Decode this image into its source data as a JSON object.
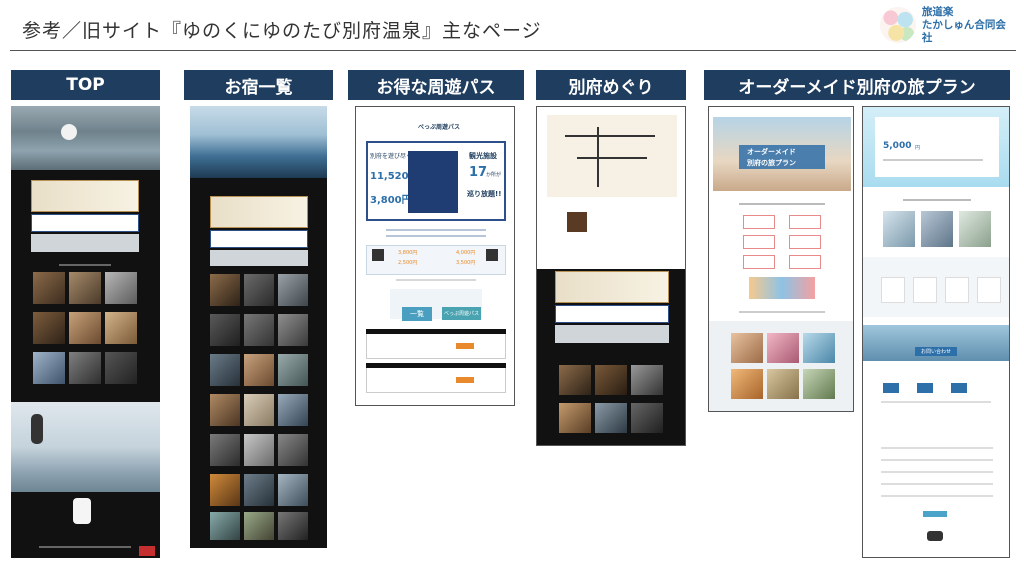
{
  "title": "参考／旧サイト『ゆのくにゆのたび別府温泉』主なページ",
  "logo": {
    "line1": "旅道楽",
    "line2": "たかしゅん合同会社",
    "icon": "flower-circle-logo"
  },
  "columns": [
    {
      "label": "TOP"
    },
    {
      "label": "お宿一覧"
    },
    {
      "label": "お得な周遊パス"
    },
    {
      "label": "別府めぐり"
    },
    {
      "label": "オーダーメイド別府の旅プラン"
    }
  ],
  "pass": {
    "brand": "べっぷ周遊パス",
    "left_copy": "別府を遊び尽くすなら",
    "price_big": "11,520円",
    "price_small": "3,800円",
    "right_copy": "観光施設",
    "count": "17",
    "count_suffix": "か所が",
    "free": "巡り放題!!",
    "btn1": "一覧",
    "btn2": "べっぷ周遊パス",
    "price_a1": "3,800円",
    "price_a2": "2,500円",
    "price_b1": "4,000円",
    "price_b2": "3,500円"
  },
  "plan": {
    "left_title": "オーダーメイド",
    "left_title2": "別府の旅プラン",
    "right_price": "5,000",
    "right_price_unit": "円",
    "btn": "お問い合わせ"
  },
  "colors": {
    "header_bg": "#1f3d5e",
    "accent_blue": "#2d6fa8",
    "accent_orange": "#e8892b"
  }
}
